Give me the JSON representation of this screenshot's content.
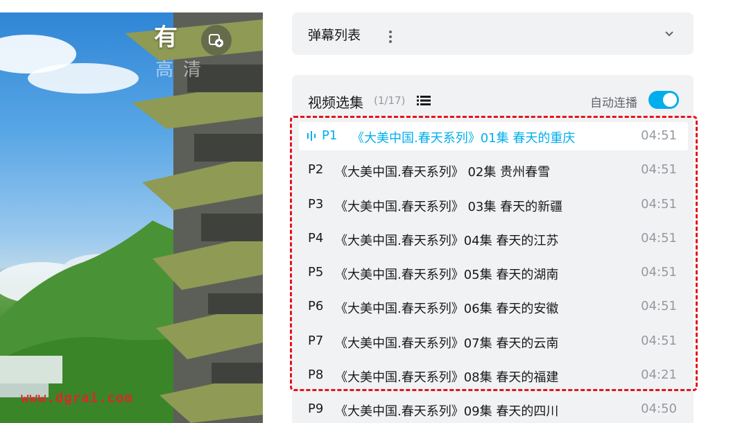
{
  "video": {
    "overlay_title": "有",
    "overlay_subtitle": "高清",
    "pip_icon": "picture-in-picture-icon",
    "watermark": "www.dgrai.com"
  },
  "danmaku": {
    "title": "弹幕列表",
    "more_icon": "more-vertical-icon",
    "expand_icon": "chevron-down-icon"
  },
  "playlist": {
    "title": "视频选集",
    "count": "(1/17)",
    "list_icon": "list-icon",
    "autoplay_label": "自动连播",
    "autoplay_on": true,
    "accent_color": "#00aeec",
    "highlight_color": "#e0151f",
    "episodes": [
      {
        "num": "P1",
        "title": "《大美中国.春天系列》01集 春天的重庆",
        "duration": "04:51",
        "active": true
      },
      {
        "num": "P2",
        "title": "《大美中国.春天系列》 02集 贵州春雪",
        "duration": "04:51",
        "active": false
      },
      {
        "num": "P3",
        "title": "《大美中国.春天系列》 03集 春天的新疆",
        "duration": "04:51",
        "active": false
      },
      {
        "num": "P4",
        "title": "《大美中国.春天系列》04集 春天的江苏",
        "duration": "04:51",
        "active": false
      },
      {
        "num": "P5",
        "title": "《大美中国.春天系列》05集 春天的湖南",
        "duration": "04:51",
        "active": false
      },
      {
        "num": "P6",
        "title": "《大美中国.春天系列》06集 春天的安徽",
        "duration": "04:51",
        "active": false
      },
      {
        "num": "P7",
        "title": "《大美中国.春天系列》07集 春天的云南",
        "duration": "04:51",
        "active": false
      },
      {
        "num": "P8",
        "title": "《大美中国.春天系列》08集 春天的福建",
        "duration": "04:21",
        "active": false
      },
      {
        "num": "P9",
        "title": "《大美中国.春天系列》09集 春天的四川",
        "duration": "04:50",
        "active": false
      }
    ]
  }
}
